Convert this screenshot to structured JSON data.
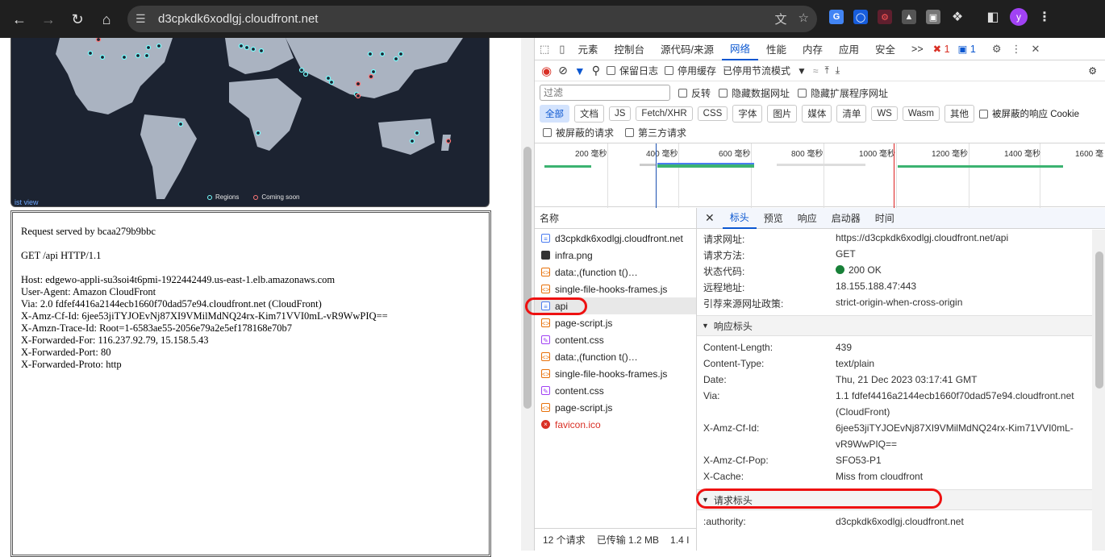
{
  "browser": {
    "url": "d3cpkdk6xodlgj.cloudfront.net",
    "avatar_letter": "y"
  },
  "map": {
    "legend": [
      "Regions",
      "Coming soon"
    ],
    "link": "ist view"
  },
  "request_text": "Request served by bcaa279b9bbc\n\nGET /api HTTP/1.1\n\nHost: edgewo-appli-su3soi4t6pmi-1922442449.us-east-1.elb.amazonaws.com\nUser-Agent: Amazon CloudFront\nVia: 2.0 fdfef4416a2144ecb1660f70dad57e94.cloudfront.net (CloudFront)\nX-Amz-Cf-Id: 6jee53jiTYJOEvNj87XI9VMilMdNQ24rx-Kim71VVI0mL-vR9WwPIQ==\nX-Amzn-Trace-Id: Root=1-6583ae55-2056e79a2e5ef178168e70b7\nX-Forwarded-For: 116.237.92.79, 15.158.5.43\nX-Forwarded-Port: 80\nX-Forwarded-Proto: http",
  "devtools": {
    "tabs": [
      "元素",
      "控制台",
      "源代码/来源",
      "网络",
      "性能",
      "内存",
      "应用",
      "安全"
    ],
    "more": ">>",
    "errors": "1",
    "messages": "1",
    "toolbar": {
      "preserve_log": "保留日志",
      "disable_cache": "停用缓存",
      "throttle": "已停用节流模式"
    },
    "filter_placeholder": "过滤",
    "filter_opts": [
      "反转",
      "隐藏数据网址",
      "隐藏扩展程序网址"
    ],
    "types": [
      "全部",
      "文档",
      "JS",
      "Fetch/XHR",
      "CSS",
      "字体",
      "图片",
      "媒体",
      "清单",
      "WS",
      "Wasm",
      "其他"
    ],
    "blocked_cookies": "被屏蔽的响应 Cookie",
    "blocked_requests": "被屏蔽的请求",
    "third_party": "第三方请求",
    "ticks": [
      "200 毫秒",
      "400 毫秒",
      "600 毫秒",
      "800 毫秒",
      "1000 毫秒",
      "1200 毫秒",
      "1400 毫秒",
      "1600 毫"
    ],
    "name_header": "名称",
    "requests": [
      {
        "name": "d3cpkdk6xodlgj.cloudfront.net",
        "type": "doc"
      },
      {
        "name": "infra.png",
        "type": "img"
      },
      {
        "name": "data:,(function t()…",
        "type": "script"
      },
      {
        "name": "single-file-hooks-frames.js",
        "type": "script"
      },
      {
        "name": "api",
        "type": "doc"
      },
      {
        "name": "page-script.js",
        "type": "script"
      },
      {
        "name": "content.css",
        "type": "css"
      },
      {
        "name": "data:,(function t()…",
        "type": "script"
      },
      {
        "name": "single-file-hooks-frames.js",
        "type": "script"
      },
      {
        "name": "content.css",
        "type": "css"
      },
      {
        "name": "page-script.js",
        "type": "script"
      },
      {
        "name": "favicon.ico",
        "type": "error"
      }
    ],
    "status_bar": [
      "12 个请求",
      "已传输 1.2 MB",
      "1.4 I"
    ],
    "detail_tabs": [
      "标头",
      "预览",
      "响应",
      "启动器",
      "时间"
    ],
    "general": [
      {
        "k": "请求网址:",
        "v": "https://d3cpkdk6xodlgj.cloudfront.net/api"
      },
      {
        "k": "请求方法:",
        "v": "GET"
      },
      {
        "k": "状态代码:",
        "v": "200 OK"
      },
      {
        "k": "远程地址:",
        "v": "18.155.188.47:443"
      },
      {
        "k": "引荐来源网址政策:",
        "v": "strict-origin-when-cross-origin"
      }
    ],
    "response_section": "响应标头",
    "response": [
      {
        "k": "Content-Length:",
        "v": "439"
      },
      {
        "k": "Content-Type:",
        "v": "text/plain"
      },
      {
        "k": "Date:",
        "v": "Thu, 21 Dec 2023 03:17:41 GMT"
      },
      {
        "k": "Via:",
        "v": "1.1 fdfef4416a2144ecb1660f70dad57e94.cloudfront.net (CloudFront)"
      },
      {
        "k": "X-Amz-Cf-Id:",
        "v": "6jee53jiTYJOEvNj87XI9VMilMdNQ24rx-Kim71VVI0mL-vR9WwPIQ=="
      },
      {
        "k": "X-Amz-Cf-Pop:",
        "v": "SFO53-P1"
      },
      {
        "k": "X-Cache:",
        "v": "Miss from cloudfront"
      }
    ],
    "request_section": "请求标头",
    "request": [
      {
        "k": ":authority:",
        "v": "d3cpkdk6xodlgj.cloudfront.net"
      }
    ]
  }
}
